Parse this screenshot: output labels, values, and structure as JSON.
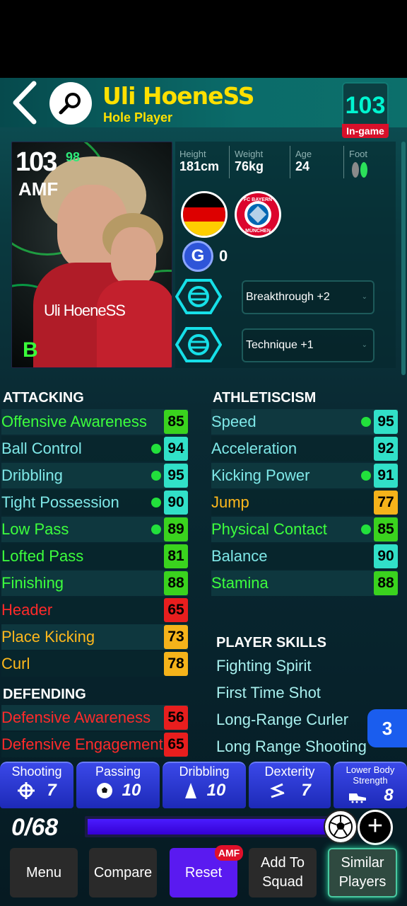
{
  "header": {
    "player_name": "Uli HoeneSS",
    "role": "Hole Player",
    "ingame_rating": "103",
    "ingame_label": "In-game"
  },
  "card": {
    "rating": "103",
    "rating_sup": "98",
    "position": "AMF",
    "name": "Uli HoeneSS",
    "grade": "B"
  },
  "info": {
    "height_label": "Height",
    "height_value": "181cm",
    "weight_label": "Weight",
    "weight_value": "76kg",
    "age_label": "Age",
    "age_value": "24",
    "foot_label": "Foot"
  },
  "club": {
    "logo_text_top": "FC BAYERN",
    "logo_text_bottom": "MÜNCHEN"
  },
  "g_points": {
    "icon": "G",
    "value": "0"
  },
  "boosters": [
    {
      "label": "Breakthrough +2"
    },
    {
      "label": "Technique +1"
    }
  ],
  "attacking": {
    "title": "ATTACKING",
    "stats": [
      {
        "name": "Offensive Awareness",
        "value": "85",
        "dot": false,
        "name_color": "#3dff3d",
        "box_color": "#3ad31e"
      },
      {
        "name": "Ball Control",
        "value": "94",
        "dot": true,
        "name_color": "#7fe8e8",
        "box_color": "#31e0c8"
      },
      {
        "name": "Dribbling",
        "value": "95",
        "dot": true,
        "name_color": "#7fe8e8",
        "box_color": "#31e0c8"
      },
      {
        "name": "Tight Possession",
        "value": "90",
        "dot": true,
        "name_color": "#7fe8e8",
        "box_color": "#31e0c8"
      },
      {
        "name": "Low Pass",
        "value": "89",
        "dot": true,
        "name_color": "#3dff3d",
        "box_color": "#3ad31e"
      },
      {
        "name": "Lofted Pass",
        "value": "81",
        "dot": false,
        "name_color": "#3dff3d",
        "box_color": "#3ad31e"
      },
      {
        "name": "Finishing",
        "value": "88",
        "dot": false,
        "name_color": "#3dff3d",
        "box_color": "#3ad31e"
      },
      {
        "name": "Header",
        "value": "65",
        "dot": false,
        "name_color": "#ff2a2a",
        "box_color": "#e81e1e"
      },
      {
        "name": "Place Kicking",
        "value": "73",
        "dot": false,
        "name_color": "#ffb81c",
        "box_color": "#f5b31a"
      },
      {
        "name": "Curl",
        "value": "78",
        "dot": false,
        "name_color": "#ffb81c",
        "box_color": "#f5b31a"
      }
    ]
  },
  "defending": {
    "title": "DEFENDING",
    "stats": [
      {
        "name": "Defensive Awareness",
        "value": "56",
        "name_color": "#ff2a2a",
        "box_color": "#e81e1e"
      },
      {
        "name": "Defensive Engagement",
        "value": "65",
        "name_color": "#ff2a2a",
        "box_color": "#e81e1e"
      }
    ]
  },
  "athleticism": {
    "title": "ATHLETISCISM",
    "stats": [
      {
        "name": "Speed",
        "value": "95",
        "dot": true,
        "name_color": "#7fe8e8",
        "box_color": "#31e0c8"
      },
      {
        "name": "Acceleration",
        "value": "92",
        "dot": false,
        "name_color": "#7fe8e8",
        "box_color": "#31e0c8"
      },
      {
        "name": "Kicking Power",
        "value": "91",
        "dot": true,
        "name_color": "#7fe8e8",
        "box_color": "#31e0c8"
      },
      {
        "name": "Jump",
        "value": "77",
        "dot": false,
        "name_color": "#ffb81c",
        "box_color": "#f5b31a"
      },
      {
        "name": "Physical Contact",
        "value": "85",
        "dot": true,
        "name_color": "#3dff3d",
        "box_color": "#3ad31e"
      },
      {
        "name": "Balance",
        "value": "90",
        "dot": false,
        "name_color": "#7fe8e8",
        "box_color": "#31e0c8"
      },
      {
        "name": "Stamina",
        "value": "88",
        "dot": false,
        "name_color": "#3dff3d",
        "box_color": "#3ad31e"
      }
    ]
  },
  "skills": {
    "title": "PLAYER SKILLS",
    "items": [
      "Fighting Spirit",
      "First Time Shot",
      "Long-Range Curler",
      "Long Range Shooting"
    ],
    "more_count": "3"
  },
  "categories": [
    {
      "label": "Shooting",
      "value": "7",
      "icon": "crosshair-icon"
    },
    {
      "label": "Passing",
      "value": "10",
      "icon": "ball-icon"
    },
    {
      "label": "Dribbling",
      "value": "10",
      "icon": "cone-icon"
    },
    {
      "label": "Dexterity",
      "value": "7",
      "icon": "arrows-icon"
    },
    {
      "label": "Lower Body Strength",
      "value": "8",
      "icon": "boot-icon"
    }
  ],
  "progress": {
    "points": "0/68",
    "fill_fraction": 0.92
  },
  "bottom": {
    "menu": "Menu",
    "compare": "Compare",
    "reset": "Reset",
    "reset_tag": "AMF",
    "add_line1": "Add To",
    "add_line2": "Squad",
    "similar_line1": "Similar",
    "similar_line2": "Players"
  }
}
